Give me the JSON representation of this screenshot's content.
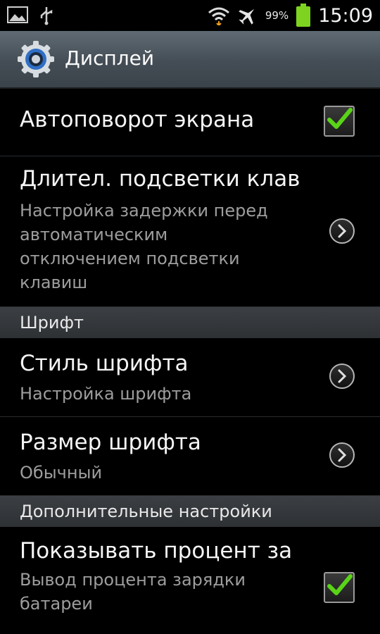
{
  "status_bar": {
    "battery_percent": "99%",
    "time": "15:09",
    "icons": [
      "gallery-icon",
      "usb-icon",
      "wifi-icon",
      "airplane-icon",
      "battery-icon"
    ],
    "battery_color": "#7ed321"
  },
  "header": {
    "title": "Дисплей",
    "icon": "settings-gear-icon",
    "accent_color": "#3a7fd5"
  },
  "items": {
    "autorotate": {
      "title": "Автоповорот экрана",
      "checked": true
    },
    "backlight": {
      "title": "Длител. подсветки клав",
      "subtitle": "Настройка задержки перед\nавтоматическим\nотключением подсветки\nклавиш"
    },
    "font_style": {
      "title": "Стиль шрифта",
      "subtitle": "Настройка шрифта"
    },
    "font_size": {
      "title": "Размер шрифта",
      "subtitle": "Обычный"
    },
    "battery_pct": {
      "title": "Показывать процент за",
      "subtitle": "Вывод процента зарядки\nбатареи",
      "checked": true
    }
  },
  "sections": {
    "font": "Шрифт",
    "advanced": "Дополнительные настройки"
  },
  "colors": {
    "check_green": "#59d417",
    "subtitle_gray": "#9d9d9d"
  }
}
